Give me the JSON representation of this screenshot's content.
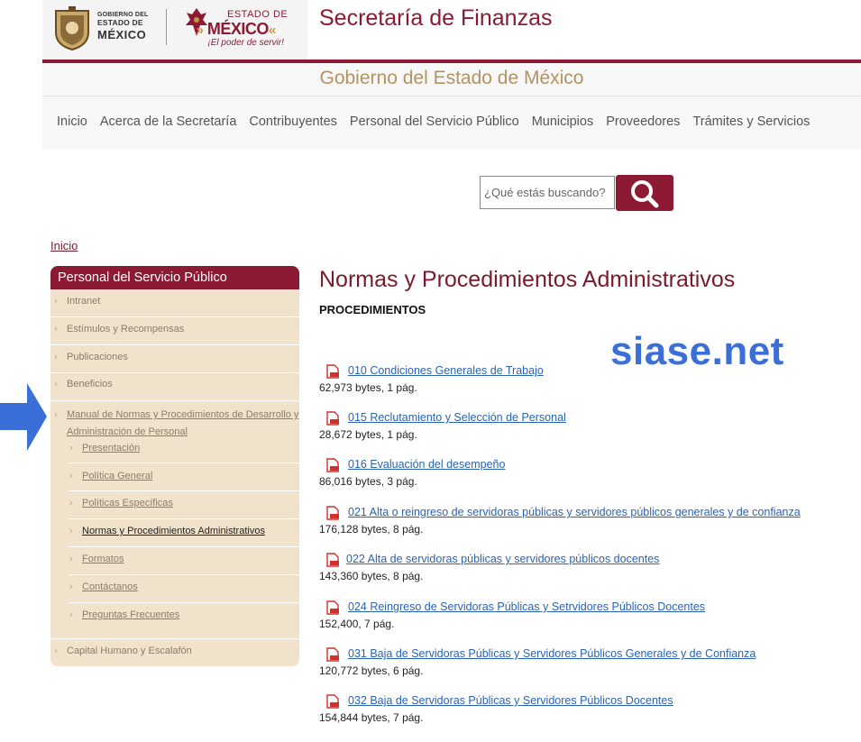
{
  "header": {
    "gobierno_small": "GOBIERNO DEL",
    "gobierno_mid": "ESTADO DE",
    "gobierno_big": "MÉXICO",
    "estado_top": "ESTADO DE",
    "estado_big": "MÉXICO",
    "estado_slogan": "¡El poder de servir!",
    "site_title": "Secretaría de Finanzas",
    "subtitle": "Gobierno del Estado de México"
  },
  "nav": {
    "items": [
      {
        "label": "Inicio"
      },
      {
        "label": "Acerca de la Secretaría"
      },
      {
        "label": "Contribuyentes"
      },
      {
        "label": "Personal del Servicio Público"
      },
      {
        "label": "Municipios"
      },
      {
        "label": "Proveedores"
      },
      {
        "label": "Trámites y Servicios"
      }
    ]
  },
  "search": {
    "placeholder": "¿Qué estás buscando?"
  },
  "breadcrumb": {
    "home": "Inicio"
  },
  "sidebar": {
    "title": "Personal del Servicio Público",
    "items": [
      {
        "label": "Intranet"
      },
      {
        "label": "Estímulos y Recompensas"
      },
      {
        "label": "Publicaciones"
      },
      {
        "label": "Beneficios"
      },
      {
        "label_line1": "Manual de Normas y Procedimientos de Desarrollo y",
        "label_line2": "Administración de Personal"
      },
      {
        "label": "Capital Humano y Escalafón"
      }
    ],
    "subitems": [
      {
        "label": "Presentación"
      },
      {
        "label": "Política General"
      },
      {
        "label": "Políticas Específicas"
      },
      {
        "label": "Normas y Procedimientos Administrativos"
      },
      {
        "label": "Formatos"
      },
      {
        "label": "Contáctanos"
      },
      {
        "label": "Preguntas Frecuentes"
      }
    ]
  },
  "main": {
    "title": "Normas y Procedimientos Administrativos",
    "section": "PROCEDIMIENTOS",
    "watermark": "siase.net",
    "documents": [
      {
        "title": "010 Condiciones Generales de Trabajo",
        "meta": "62,973 bytes, 1 pág."
      },
      {
        "title": "015 Reclutamiento y Selección de Personal",
        "meta": "28,672 bytes, 1 pág."
      },
      {
        "title": "016 Evaluación del desempeño",
        "meta": "86,016 bytes, 3 pág."
      },
      {
        "title": "021 Alta o reingreso de servidoras públicas y servidores públicos generales y de confianza",
        "meta": "176,128 bytes, 8 pág."
      },
      {
        "title": "022 Alta de servidoras públicas y servidores públicos docentes",
        "meta": "143,360 bytes, 8 pág."
      },
      {
        "title": "024 Reingreso de Servidoras Públicas y Setrvidores Públicos Docentes",
        "meta": "152,400, 7 pág."
      },
      {
        "title": "031 Baja de Servidoras Públicas y Servidores Públicos Generales y de Confianza",
        "meta": "120,772 bytes, 6 pág."
      },
      {
        "title": "032 Baja de Servidoras Públicas y Servidores Públicos Docentes",
        "meta": "154,844 bytes, 7 pág."
      }
    ]
  },
  "colors": {
    "maroon": "#8b1a32",
    "gold": "#b29364",
    "link": "#2a63b3",
    "sidebar_bg": "#f1e2cc",
    "arrow": "#3a6fd8"
  }
}
